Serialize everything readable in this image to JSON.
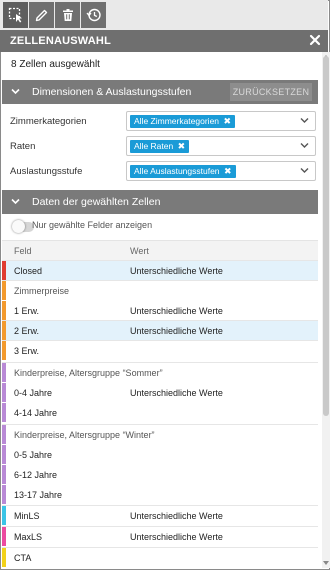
{
  "colors": {
    "accent": "#1a9bd7",
    "header_bg": "#6f6f6f",
    "section_bg": "#7a7a7a",
    "highlight_row": "#e3f2fb",
    "bar_red": "#e03c31",
    "bar_orange": "#f39a2e",
    "bar_purple": "#b98ad6",
    "bar_cyan": "#3bc4e6",
    "bar_pink": "#ec4ba0",
    "bar_yellow": "#f2d21b"
  },
  "toolbar": {
    "tools": [
      {
        "icon": "selection-icon"
      },
      {
        "icon": "pencil-icon"
      },
      {
        "icon": "trash-icon"
      },
      {
        "icon": "history-icon"
      }
    ]
  },
  "panel": {
    "title": "ZELLENAUSWAHL",
    "selected_count": "8 Zellen ausgewählt"
  },
  "dimensions": {
    "title": "Dimensionen & Auslastungsstufen",
    "reset_label": "ZURÜCKSETZEN",
    "filters": [
      {
        "label": "Zimmerkategorien",
        "tag": "Alle Zimmerkategorien"
      },
      {
        "label": "Raten",
        "tag": "Alle Raten"
      },
      {
        "label": "Auslastungsstufe",
        "tag": "Alle Auslastungsstufen"
      }
    ]
  },
  "cells": {
    "title": "Daten der gewählten Zellen",
    "toggle_label": "Nur gewählte Felder anzeigen",
    "col_field": "Feld",
    "col_value": "Wert",
    "rows": [
      {
        "field": "Closed",
        "value": "Unterschiedliche Werte"
      },
      {
        "field": "Zimmerpreise",
        "value": ""
      },
      {
        "field": "1 Erw.",
        "value": "Unterschiedliche Werte"
      },
      {
        "field": "2 Erw.",
        "value": "Unterschiedliche Werte"
      },
      {
        "field": "3 Erw.",
        "value": ""
      },
      {
        "field": "Kinderpreise, Altersgruppe “Sommer”",
        "value": ""
      },
      {
        "field": "0-4 Jahre",
        "value": "Unterschiedliche Werte"
      },
      {
        "field": "4-14 Jahre",
        "value": ""
      },
      {
        "field": "Kinderpreise, Altersgruppe “Winter”",
        "value": ""
      },
      {
        "field": "0-5 Jahre",
        "value": ""
      },
      {
        "field": "6-12 Jahre",
        "value": ""
      },
      {
        "field": "13-17 Jahre",
        "value": ""
      },
      {
        "field": "MinLS",
        "value": "Unterschiedliche Werte"
      },
      {
        "field": "MaxLS",
        "value": "Unterschiedliche Werte"
      },
      {
        "field": "CTA",
        "value": ""
      }
    ]
  }
}
